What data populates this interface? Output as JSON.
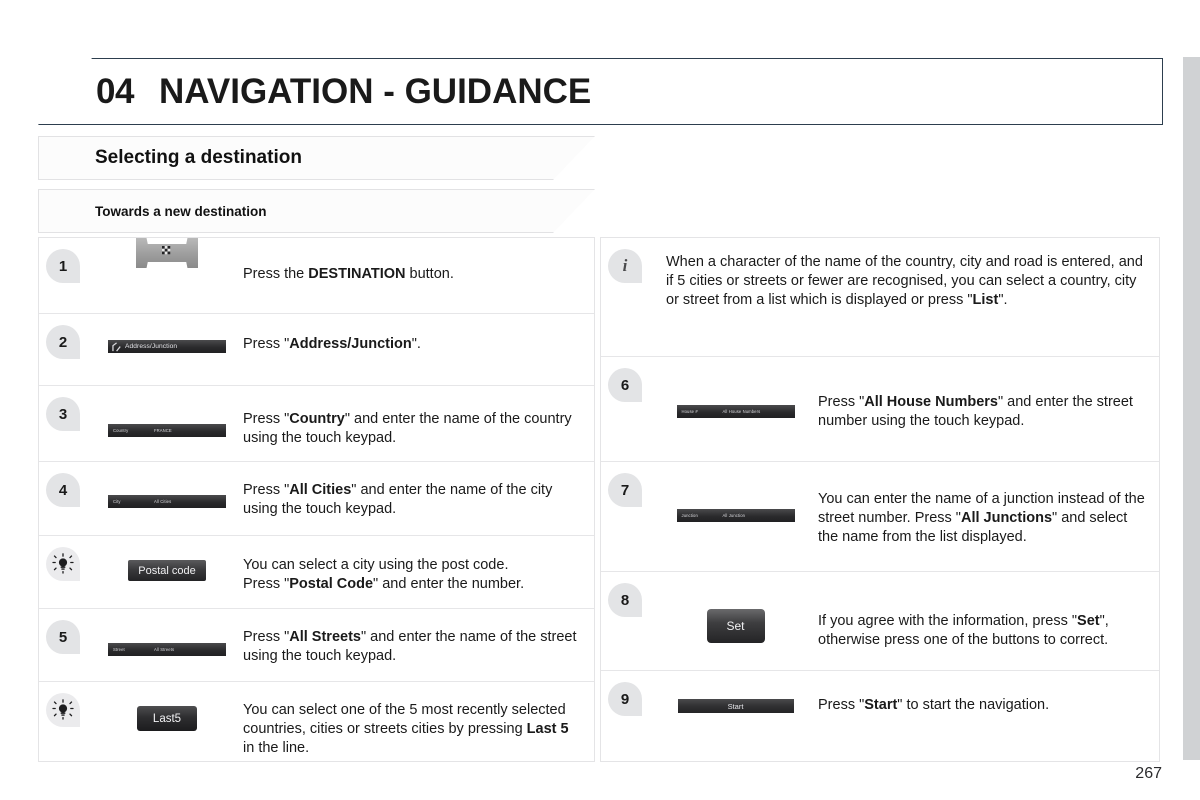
{
  "chapter": {
    "number": "04",
    "title": "NAVIGATION - GUIDANCE"
  },
  "sections": {
    "primary": "Selecting a destination",
    "secondary": "Towards a new destination"
  },
  "left_steps": [
    {
      "badge": "1",
      "badge_type": "number",
      "graphic": "hardware-destination-button",
      "graphic_labels": {
        "icon": "checkered-flag-icon"
      },
      "text_parts": [
        {
          "t": "Press the ",
          "b": false
        },
        {
          "t": "DESTINATION",
          "b": true
        },
        {
          "t": " button.",
          "b": false
        }
      ]
    },
    {
      "badge": "2",
      "badge_type": "number",
      "graphic": "nav-bar-address-junction",
      "graphic_labels": {
        "left": "Address/Junction"
      },
      "text_parts": [
        {
          "t": "Press \"",
          "b": false
        },
        {
          "t": "Address/Junction",
          "b": true
        },
        {
          "t": "\".",
          "b": false
        }
      ]
    },
    {
      "badge": "3",
      "badge_type": "number",
      "graphic": "nav-bar-country",
      "graphic_labels": {
        "left": "Country",
        "right": "FRANCE"
      },
      "text_parts": [
        {
          "t": "Press \"",
          "b": false
        },
        {
          "t": "Country",
          "b": true
        },
        {
          "t": "\" and enter the name of the country using the touch keypad.",
          "b": false
        }
      ]
    },
    {
      "badge": "4",
      "badge_type": "number",
      "graphic": "nav-bar-city",
      "graphic_labels": {
        "left": "City",
        "right": "All Cities"
      },
      "text_parts": [
        {
          "t": "Press \"",
          "b": false
        },
        {
          "t": "All Cities",
          "b": true
        },
        {
          "t": "\" and enter the name of the city using the touch keypad.",
          "b": false
        }
      ]
    },
    {
      "badge": "tip",
      "badge_type": "tip",
      "graphic": "button-postal-code",
      "graphic_labels": {
        "label": "Postal code"
      },
      "text_parts": [
        {
          "t": "You can select a city using the post code.\nPress \"",
          "b": false
        },
        {
          "t": "Postal Code",
          "b": true
        },
        {
          "t": "\" and enter the number.",
          "b": false
        }
      ]
    },
    {
      "badge": "5",
      "badge_type": "number",
      "graphic": "nav-bar-street",
      "graphic_labels": {
        "left": "Street",
        "right": "All Streets"
      },
      "text_parts": [
        {
          "t": "Press \"",
          "b": false
        },
        {
          "t": "All Streets",
          "b": true
        },
        {
          "t": "\" and enter the name of the street using the touch keypad.",
          "b": false
        }
      ]
    },
    {
      "badge": "tip",
      "badge_type": "tip",
      "graphic": "button-last5",
      "graphic_labels": {
        "label": "Last5"
      },
      "text_parts": [
        {
          "t": "You can select one of the 5 most recently selected countries, cities or streets cities by pressing ",
          "b": false
        },
        {
          "t": "Last 5",
          "b": true
        },
        {
          "t": " in the line.",
          "b": false
        }
      ]
    }
  ],
  "info_note": {
    "badge": "i",
    "text_parts": [
      {
        "t": "When a character of the name of the country, city and road is entered, and if 5 cities or streets or fewer are recognised, you can select a country, city or street from a list which is displayed or press \"",
        "b": false
      },
      {
        "t": "List",
        "b": true
      },
      {
        "t": "\".",
        "b": false
      }
    ]
  },
  "right_steps": [
    {
      "badge": "6",
      "badge_type": "number",
      "graphic": "nav-bar-house-number",
      "graphic_labels": {
        "left": "House #",
        "right": "All House Numbers"
      },
      "text_parts": [
        {
          "t": "Press \"",
          "b": false
        },
        {
          "t": "All House Numbers",
          "b": true
        },
        {
          "t": "\" and enter the street number using the touch keypad.",
          "b": false
        }
      ]
    },
    {
      "badge": "7",
      "badge_type": "number",
      "graphic": "nav-bar-junction",
      "graphic_labels": {
        "left": "Junction",
        "right": "All Junction"
      },
      "text_parts": [
        {
          "t": "You can enter the name of a junction instead of the street number. Press \"",
          "b": false
        },
        {
          "t": "All Junctions",
          "b": true
        },
        {
          "t": "\" and select the name from the list displayed.",
          "b": false
        }
      ]
    },
    {
      "badge": "8",
      "badge_type": "number",
      "graphic": "button-set",
      "graphic_labels": {
        "label": "Set"
      },
      "text_parts": [
        {
          "t": "If you agree with the information, press \"",
          "b": false
        },
        {
          "t": "Set",
          "b": true
        },
        {
          "t": "\", otherwise press one of the buttons to correct.",
          "b": false
        }
      ]
    },
    {
      "badge": "9",
      "badge_type": "number",
      "graphic": "bar-start",
      "graphic_labels": {
        "label": "Start"
      },
      "text_parts": [
        {
          "t": "Press \"",
          "b": false
        },
        {
          "t": "Start",
          "b": true
        },
        {
          "t": "\" to start the navigation.",
          "b": false
        }
      ]
    }
  ],
  "page_number": "267",
  "colors": {
    "title_border": "#2d3e4e",
    "badge_bg": "#e3e4e6",
    "edge_tab": "#d0d2d4",
    "screen_dark": "#2b2b2d"
  }
}
